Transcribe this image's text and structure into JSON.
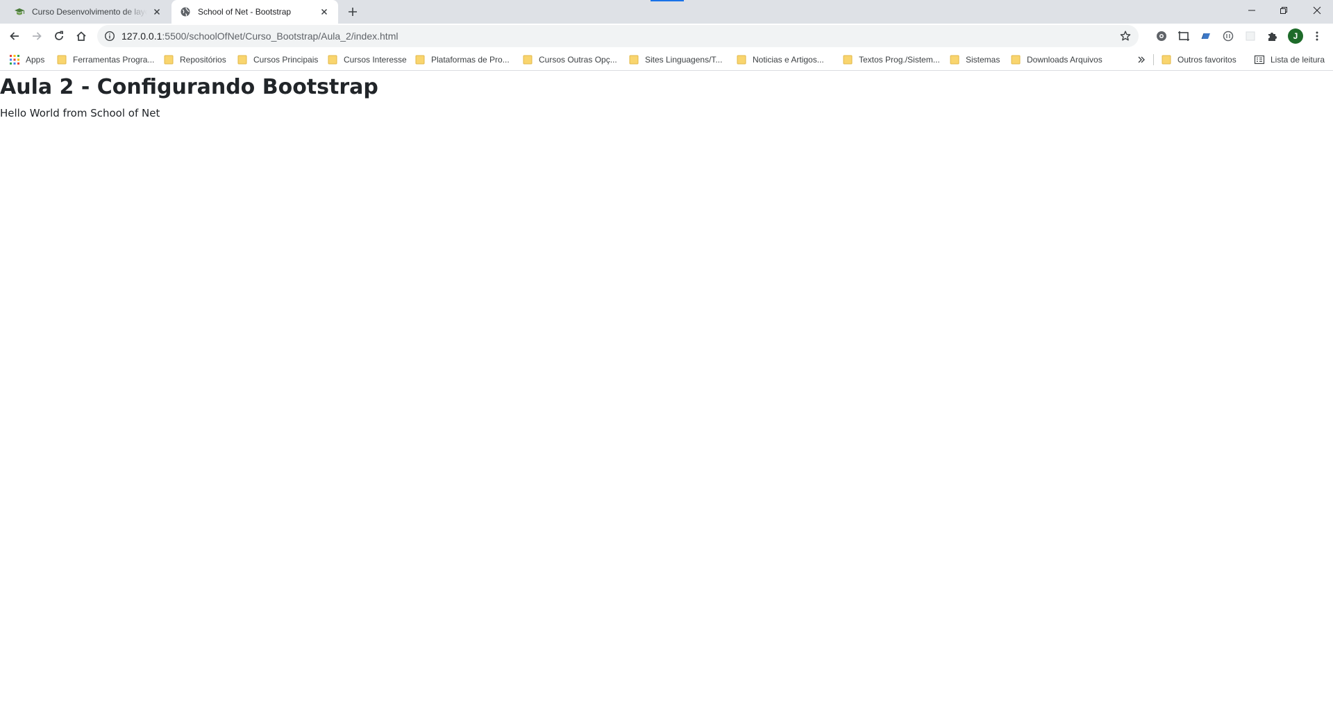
{
  "browser": {
    "tabs": [
      {
        "title": "Curso Desenvolvimento de layout",
        "favicon": "graduation-cap-icon",
        "active": false
      },
      {
        "title": "School of Net - Bootstrap",
        "favicon": "globe-icon",
        "active": true
      }
    ],
    "url": {
      "host": "127.0.0.1",
      "path": ":5500/schoolOfNet/Curso_Bootstrap/Aula_2/index.html"
    },
    "avatar_initial": "J",
    "colors": {
      "tabstrip": "#dee1e6",
      "omnibox": "#f1f3f4",
      "folder": "#f9d56e",
      "avatar": "#1e6b2a",
      "accent": "#1a73e8"
    }
  },
  "bookmarks": {
    "apps_label": "Apps",
    "items": [
      "Ferramentas Progra...",
      "Repositórios",
      "Cursos Principais",
      "Cursos Interesse",
      "Plataformas de Pro...",
      "Cursos Outras Opç...",
      "Sites Linguagens/T...",
      "Noticias e Artigos...",
      "Textos Prog./Sistem...",
      "Sistemas",
      "Downloads Arquivos"
    ],
    "other_favorites": "Outros favoritos",
    "reading_list": "Lista de leitura"
  },
  "page": {
    "heading": "Aula 2 - Configurando Bootstrap",
    "text": "Hello World from School of Net"
  }
}
